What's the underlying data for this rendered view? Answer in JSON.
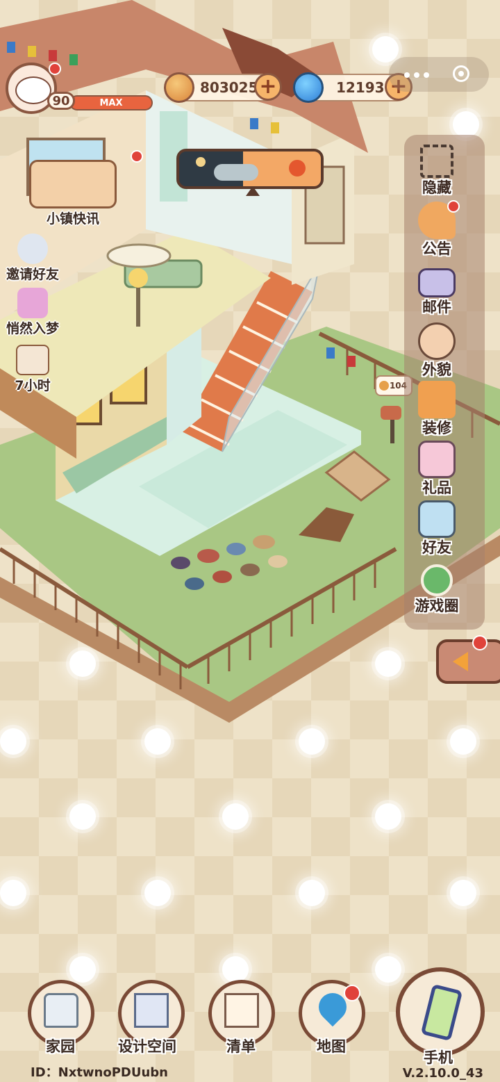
{
  "player": {
    "level": "90",
    "level_status": "MAX"
  },
  "currency": {
    "coins": "803025",
    "gems": "12193"
  },
  "left_events": [
    {
      "label": "小镇快讯"
    },
    {
      "label": "邀请好友"
    },
    {
      "label": "悄然入梦"
    },
    {
      "label": "7小时"
    }
  ],
  "scene": {
    "visitor_count": "104"
  },
  "right_menu": [
    {
      "label": "隐藏",
      "icon": "hide-icon"
    },
    {
      "label": "公告",
      "icon": "announcement-icon"
    },
    {
      "label": "邮件",
      "icon": "mail-icon"
    },
    {
      "label": "外貌",
      "icon": "appearance-icon"
    },
    {
      "label": "装修",
      "icon": "decorate-icon"
    },
    {
      "label": "礼品",
      "icon": "gift-icon"
    },
    {
      "label": "好友",
      "icon": "friends-icon"
    },
    {
      "label": "游戏圈",
      "icon": "game-circle-icon"
    }
  ],
  "bottom_nav": [
    {
      "label": "家园",
      "icon": "home-icon"
    },
    {
      "label": "设计空间",
      "icon": "design-space-icon"
    },
    {
      "label": "清单",
      "icon": "checklist-icon"
    },
    {
      "label": "地图",
      "icon": "map-icon"
    },
    {
      "label": "手机",
      "icon": "phone-icon"
    }
  ],
  "footer": {
    "id_text": "ID：NxtwnoPDUubn",
    "version": "V.2.10.0_43"
  },
  "colors": {
    "accent": "#e8643f",
    "brown": "#7a4a36",
    "grass": "#a9c784",
    "notification": "#e0423a"
  }
}
